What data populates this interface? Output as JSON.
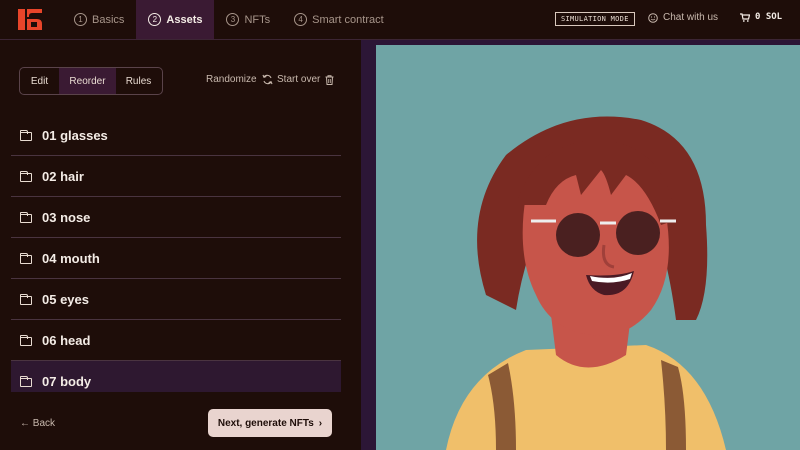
{
  "topbar": {
    "steps": [
      {
        "num": "1",
        "label": "Basics"
      },
      {
        "num": "2",
        "label": "Assets"
      },
      {
        "num": "3",
        "label": "NFTs"
      },
      {
        "num": "4",
        "label": "Smart contract"
      }
    ],
    "active_step": "Assets",
    "simulation_badge": "SIMULATION MODE",
    "chat_label": "Chat with us",
    "cart_label": "0 SOL"
  },
  "toolbar": {
    "tabs": [
      "Edit",
      "Reorder",
      "Rules"
    ],
    "active_tab": "Reorder",
    "randomize_label": "Randomize",
    "start_over_label": "Start over"
  },
  "layers": [
    {
      "label": "01 glasses"
    },
    {
      "label": "02 hair"
    },
    {
      "label": "03 nose"
    },
    {
      "label": "04 mouth"
    },
    {
      "label": "05 eyes"
    },
    {
      "label": "06 head"
    },
    {
      "label": "07 body"
    }
  ],
  "footer": {
    "back_label": "Back",
    "next_label": "Next, generate NFTs"
  },
  "colors": {
    "background": "#1e0d09",
    "accent_panel": "#3a1a33",
    "preview_bg": "#6fa4a5",
    "brand": "#e8452a"
  },
  "icons": {
    "logo": "brand-logo",
    "randomize": "refresh-icon",
    "start_over": "trash-icon",
    "layer": "folder-icon",
    "cart": "cart-icon",
    "chat": "smiley-icon"
  }
}
